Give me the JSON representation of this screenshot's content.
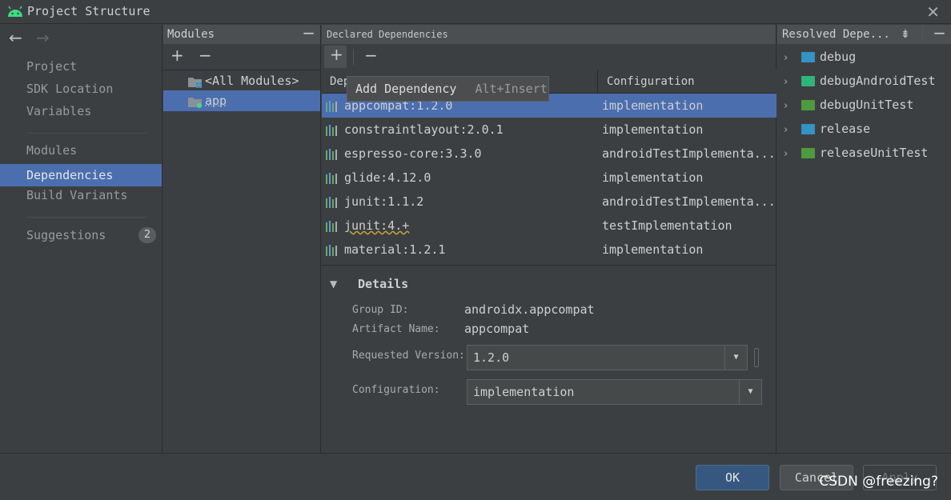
{
  "window": {
    "title": "Project Structure"
  },
  "nav": {
    "items": [
      {
        "label": "Project"
      },
      {
        "label": "SDK Location"
      },
      {
        "label": "Variables"
      },
      {
        "label": "Modules"
      },
      {
        "label": "Dependencies"
      },
      {
        "label": "Build Variants"
      },
      {
        "label": "Suggestions"
      }
    ],
    "suggestions_count": "2",
    "selected": "Dependencies"
  },
  "modules": {
    "header": "Modules",
    "rows": [
      {
        "label": "<All Modules>"
      },
      {
        "label": "app"
      }
    ],
    "selected": "app"
  },
  "declared": {
    "header": "Declared Dependencies",
    "col_dependency": "Dep",
    "col_configuration": "Configuration",
    "rows": [
      {
        "name": "appcompat:1.2.0",
        "config": "implementation"
      },
      {
        "name": "constraintlayout:2.0.1",
        "config": "implementation"
      },
      {
        "name": "espresso-core:3.3.0",
        "config": "androidTestImplementa..."
      },
      {
        "name": "glide:4.12.0",
        "config": "implementation"
      },
      {
        "name": "junit:1.1.2",
        "config": "androidTestImplementa..."
      },
      {
        "name": "junit:4.+",
        "config": "testImplementation"
      },
      {
        "name": "material:1.2.1",
        "config": "implementation"
      }
    ],
    "selected_row": "appcompat:1.2.0"
  },
  "tooltip": {
    "label": "Add Dependency",
    "shortcut": "Alt+Insert"
  },
  "details": {
    "title": "Details",
    "group_id_label": "Group ID:",
    "group_id": "androidx.appcompat",
    "artifact_label": "Artifact Name:",
    "artifact": "appcompat",
    "version_label": "Requested Version:",
    "version": "1.2.0",
    "config_label": "Configuration:",
    "config": "implementation"
  },
  "resolved": {
    "header": "Resolved Depe...",
    "items": [
      {
        "label": "debug",
        "color": "#3592c4"
      },
      {
        "label": "debugAndroidTest",
        "color": "#2fb47a"
      },
      {
        "label": "debugUnitTest",
        "color": "#4e9a3e"
      },
      {
        "label": "release",
        "color": "#3592c4"
      },
      {
        "label": "releaseUnitTest",
        "color": "#4e9a3e"
      }
    ]
  },
  "footer": {
    "ok": "OK",
    "cancel": "Cancel",
    "apply": "Apply"
  },
  "watermark": "CSDN @freezing?",
  "colors": {
    "accent": "#4b6eaf",
    "bg": "#3c3f41"
  }
}
